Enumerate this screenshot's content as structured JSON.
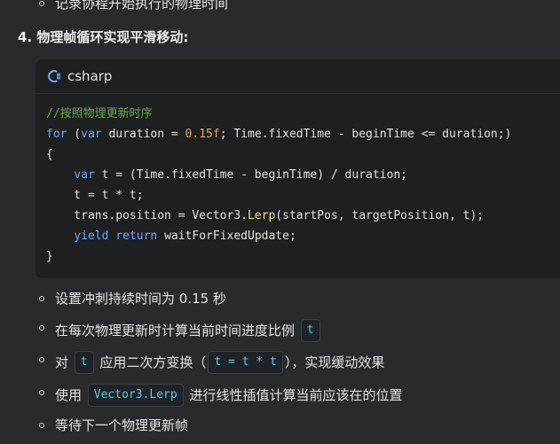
{
  "top_bullet": "记录协程开始执行的物理时间",
  "heading": "4. 物理帧循环实现平滑移动:",
  "code_block": {
    "language": "csharp",
    "icon": "code-file-icon",
    "lines": [
      [
        {
          "t": "//按照物理更新时序",
          "c": "comment"
        }
      ],
      [
        {
          "t": "for",
          "c": "kw"
        },
        {
          "t": " (",
          "c": "plain"
        },
        {
          "t": "var",
          "c": "kw"
        },
        {
          "t": " duration = ",
          "c": "plain"
        },
        {
          "t": "0.15f",
          "c": "num"
        },
        {
          "t": "; Time.fixedTime - beginTime <= duration;)",
          "c": "plain"
        }
      ],
      [
        {
          "t": "{",
          "c": "plain"
        }
      ],
      [
        {
          "t": "    ",
          "c": "plain"
        },
        {
          "t": "var",
          "c": "kw"
        },
        {
          "t": " t = (Time.fixedTime - beginTime) / duration;",
          "c": "plain"
        }
      ],
      [
        {
          "t": "    t = t * t;",
          "c": "plain"
        }
      ],
      [
        {
          "t": "    trans.position = Vector3.",
          "c": "plain"
        },
        {
          "t": "Lerp",
          "c": "fn"
        },
        {
          "t": "(startPos, targetPosition, t);",
          "c": "plain"
        }
      ],
      [
        {
          "t": "    ",
          "c": "plain"
        },
        {
          "t": "yield",
          "c": "kw"
        },
        {
          "t": " ",
          "c": "plain"
        },
        {
          "t": "return",
          "c": "kw"
        },
        {
          "t": " waitForFixedUpdate;",
          "c": "plain"
        }
      ],
      [
        {
          "t": "}",
          "c": "plain"
        }
      ]
    ]
  },
  "bullets": [
    [
      {
        "t": "设置冲刺持续时间为 0.15 秒",
        "k": "text"
      }
    ],
    [
      {
        "t": "在每次物理更新时计算当前时间进度比例 ",
        "k": "text"
      },
      {
        "t": "t",
        "k": "code"
      }
    ],
    [
      {
        "t": "对 ",
        "k": "text"
      },
      {
        "t": "t",
        "k": "code"
      },
      {
        "t": " 应用二次方变换（",
        "k": "text"
      },
      {
        "t": "t = t * t",
        "k": "code"
      },
      {
        "t": "），实现缓动效果",
        "k": "text"
      }
    ],
    [
      {
        "t": "使用 ",
        "k": "text"
      },
      {
        "t": "Vector3.Lerp",
        "k": "code"
      },
      {
        "t": " 进行线性插值计算当前应该在的位置",
        "k": "text"
      }
    ],
    [
      {
        "t": "等待下一个物理更新帧",
        "k": "text"
      }
    ]
  ],
  "colors": {
    "background": "#292a2d",
    "code_background": "#1e1f20",
    "keyword": "#6ea8fe",
    "comment": "#6aa84f",
    "number": "#e3a86b",
    "function": "#eaea8a",
    "inline_code": "#5fc9e6"
  }
}
